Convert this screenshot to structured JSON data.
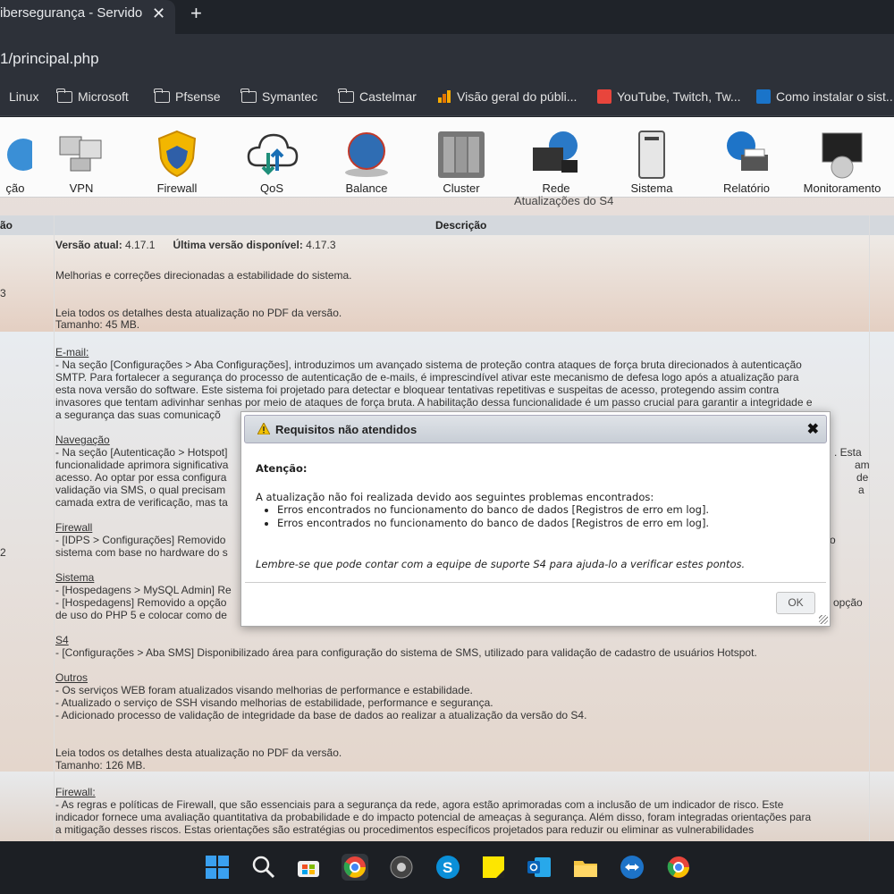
{
  "browser": {
    "tab_title": "ibersegurança - Servidor",
    "tab_close": "✕",
    "new_tab": "+",
    "url": "1/principal.php",
    "bookmarks": [
      {
        "label": "Linux"
      },
      {
        "label": "Microsoft"
      },
      {
        "label": "Pfsense"
      },
      {
        "label": "Symantec"
      },
      {
        "label": "Castelmar"
      },
      {
        "label": "Visão geral do públi..."
      },
      {
        "label": "YouTube, Twitch, Tw..."
      },
      {
        "label": "Como instalar o sist..."
      }
    ]
  },
  "toolbar": {
    "items": [
      {
        "label": "ção"
      },
      {
        "label": "VPN"
      },
      {
        "label": "Firewall"
      },
      {
        "label": "QoS"
      },
      {
        "label": "Balance"
      },
      {
        "label": "Cluster"
      },
      {
        "label": "Rede"
      },
      {
        "label": "Sistema"
      },
      {
        "label": "Relatório"
      },
      {
        "label": "Monitoramento"
      }
    ]
  },
  "page": {
    "section_title": "Atualizações do S4",
    "col_left": "ão",
    "col_desc": "Descrição",
    "row1": {
      "left": "3",
      "current_label": "Versão atual:",
      "current_value": "4.17.1",
      "latest_label": "Última versão disponível:",
      "latest_value": "4.17.3",
      "summary": "Melhorias e correções direcionadas a estabilidade do sistema.",
      "pdf": "Leia todos os detalhes desta atualização no PDF da versão.",
      "size": "Tamanho: 45 MB."
    },
    "row2": {
      "left": "2",
      "email_h": "E-mail:",
      "email_1": "- Na seção [Configurações > Aba Configurações], introduzimos um avançado sistema de proteção contra ataques de força bruta direcionados à autenticação",
      "email_2": "SMTP. Para fortalecer a segurança do processo de autenticação de e-mails, é imprescindível ativar este mecanismo de defesa logo após a atualização para",
      "email_3": "esta nova versão do software. Este sistema foi projetado para detectar e bloquear tentativas repetitivas e suspeitas de acesso, protegendo assim contra",
      "email_4": "invasores que tentam adivinhar senhas por meio de ataques de força bruta. A habilitação dessa funcionalidade é um passo crucial para garantir a integridade e",
      "email_5": "a segurança das suas comunicaçõ",
      "nav_h": "Navegação",
      "nav_1": "- Na seção [Autenticação > Hotspot]",
      "nav_1r": ". Esta",
      "nav_2": "funcionalidade aprimora significativa",
      "nav_2r": "am",
      "nav_3": "acesso. Ao optar por essa configura",
      "nav_3r": "de",
      "nav_4": "validação via SMS, o qual precisam",
      "nav_4r": "a",
      "nav_5": "camada extra de verificação, mas ta",
      "fw_h": "Firewall",
      "fw_1": "- [IDPS > Configurações] Removido",
      "fw_1r": "o",
      "fw_2": "sistema com base no hardware do s",
      "sys_h": "Sistema",
      "sys_1": "- [Hospedagens > MySQL Admin] Re",
      "sys_2": "- [Hospedagens] Removido a opção",
      "sys_2r": "opção",
      "sys_3": "de uso do PHP 5 e colocar como de",
      "s4_h": "S4",
      "s4_1": "- [Configurações > Aba SMS] Disponibilizado área para configuração do sistema de SMS, utilizado para validação de cadastro de usuários Hotspot.",
      "out_h": "Outros",
      "out_1": "- Os serviços WEB foram atualizados visando melhorias de performance e estabilidade.",
      "out_2": "- Atualizado o serviço de SSH visando melhorias de estabilidade, performance e segurança.",
      "out_3": "- Adicionado processo de validação de integridade da base de dados ao realizar a atualização da versão do S4.",
      "pdf": "Leia todos os detalhes desta atualização no PDF da versão.",
      "size": "Tamanho: 126 MB."
    },
    "row3": {
      "fw_h": "Firewall:",
      "fw_1": "- As regras e políticas de Firewall, que são essenciais para a segurança da rede, agora estão aprimoradas com a inclusão de um indicador de risco. Este",
      "fw_2": "indicador fornece uma avaliação quantitativa da probabilidade e do impacto potencial de ameaças à segurança. Além disso, foram integradas orientações para",
      "fw_3": "a mitigação desses riscos. Estas orientações são estratégias ou procedimentos específicos projetados para reduzir ou eliminar as vulnerabilidades"
    }
  },
  "modal": {
    "title": "Requisitos não atendidos",
    "close": "✖",
    "attention": "Atenção:",
    "intro": "A atualização não foi realizada devido aos seguintes problemas encontrados:",
    "errors": [
      "Erros encontrados no funcionamento do banco de dados [Registros de erro em log].",
      "Erros encontrados no funcionamento do banco de dados [Registros de erro em log]."
    ],
    "note": "Lembre-se que pode contar com a equipe de suporte S4 para ajuda-lo a verificar estes pontos.",
    "ok": "OK"
  },
  "taskbar": {
    "icons": [
      "windows-start-icon",
      "search-icon",
      "store-icon",
      "chrome-icon",
      "media-icon",
      "skype-icon",
      "sticky-notes-icon",
      "outlook-icon",
      "file-explorer-icon",
      "teamviewer-icon",
      "chrome-profile-icon"
    ]
  },
  "colors": {
    "accent_blue": "#1a74c9",
    "dialog_header": "#c8ced6"
  }
}
